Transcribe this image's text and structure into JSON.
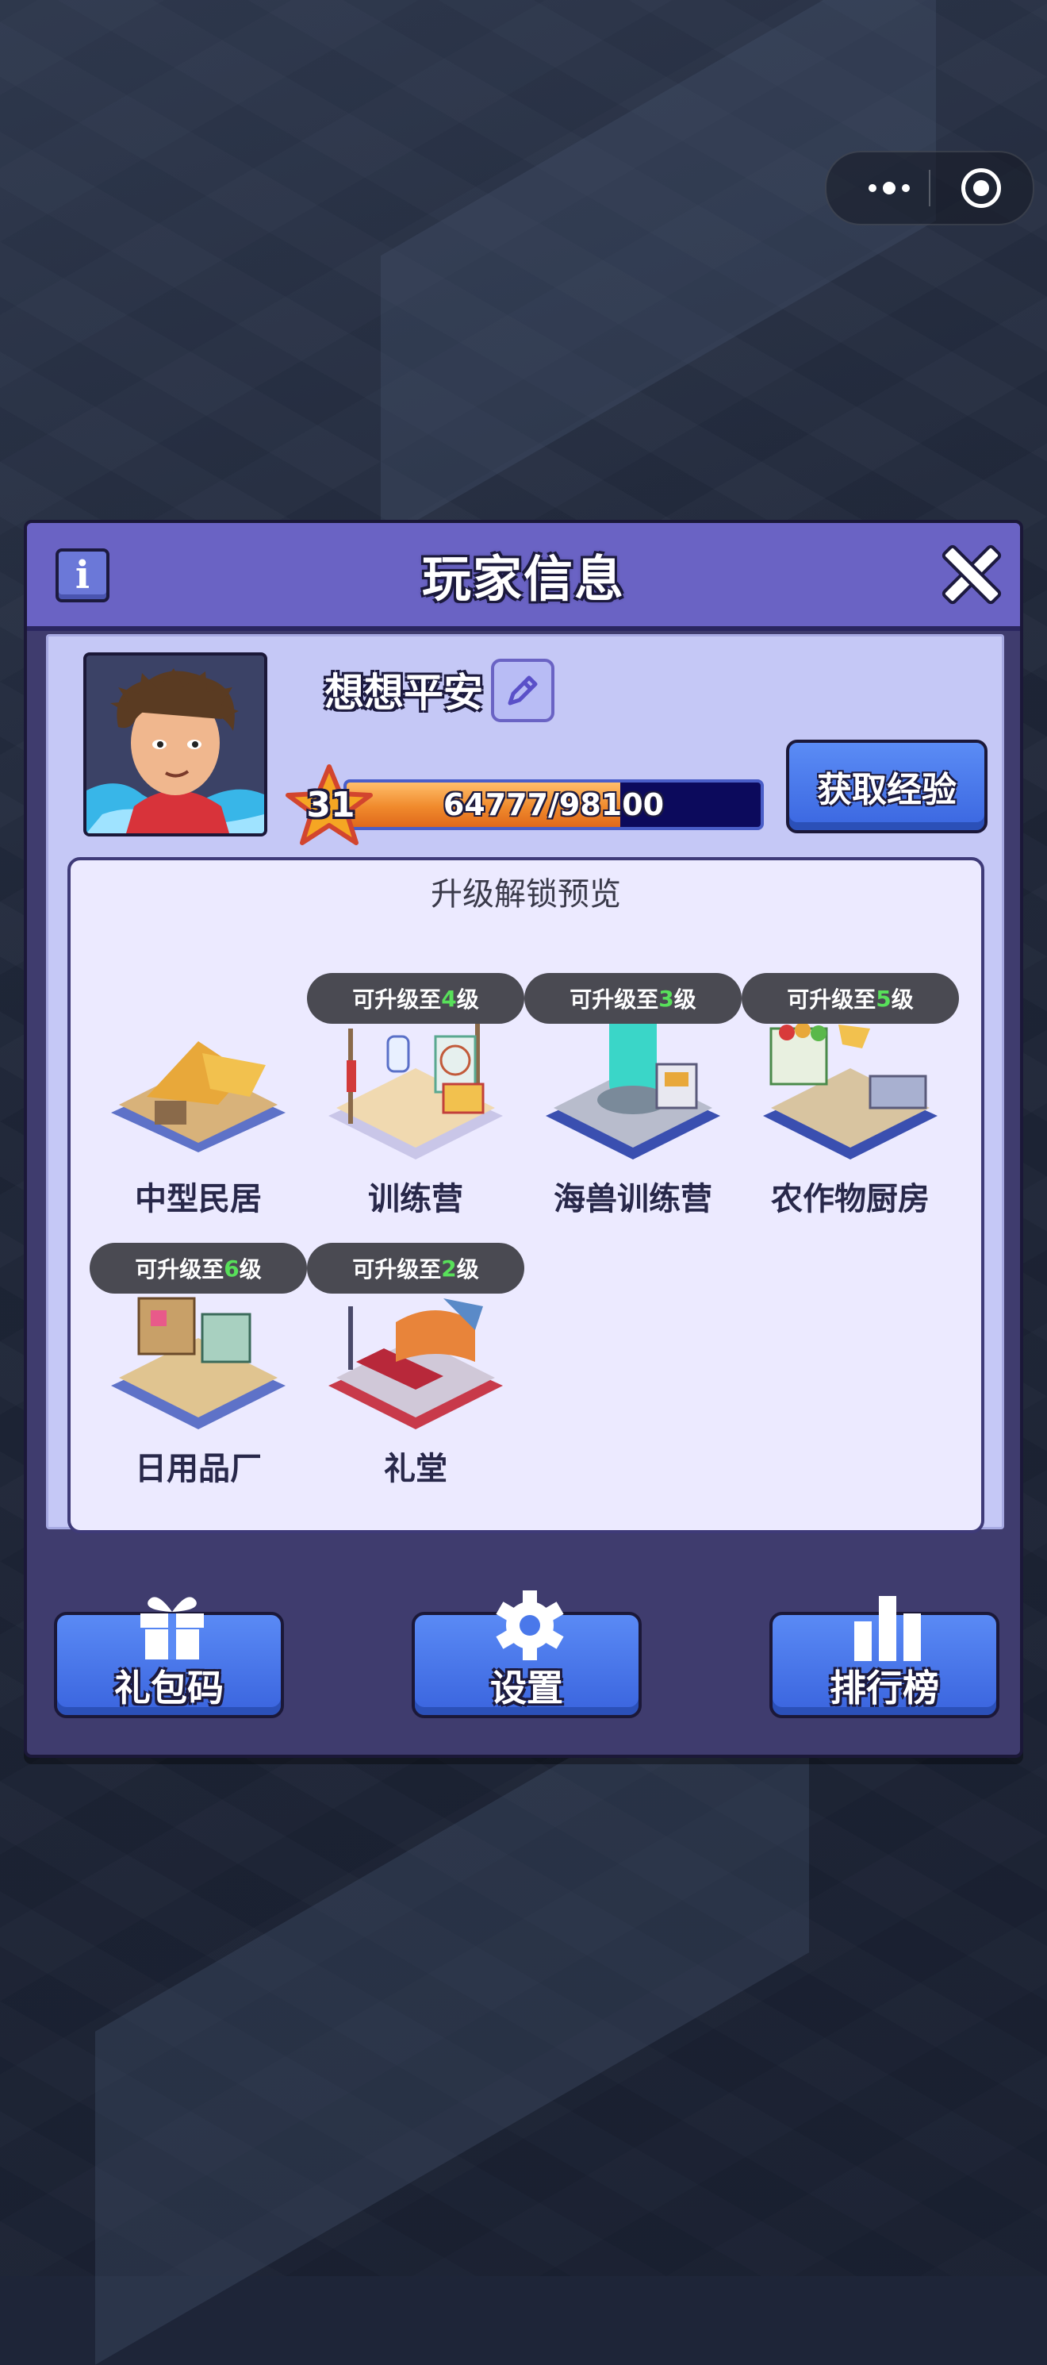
{
  "modal": {
    "title": "玩家信息",
    "info_label": "i"
  },
  "player": {
    "name": "想想平安",
    "level": "31",
    "xp_text": "64777/98100",
    "xp_fraction": 0.66,
    "get_exp_label": "获取经验"
  },
  "preview": {
    "title": "升级解锁预览",
    "badge_prefix": "可升级至",
    "badge_suffix": "级",
    "buildings": [
      {
        "name": "中型民居",
        "upgrade_level": null
      },
      {
        "name": "训练营",
        "upgrade_level": "4"
      },
      {
        "name": "海兽训练营",
        "upgrade_level": "3"
      },
      {
        "name": "农作物厨房",
        "upgrade_level": "5"
      },
      {
        "name": "日用品厂",
        "upgrade_level": "6"
      },
      {
        "name": "礼堂",
        "upgrade_level": "2"
      }
    ]
  },
  "bottom": {
    "gift_label": "礼包码",
    "settings_label": "设置",
    "ranking_label": "排行榜"
  },
  "colors": {
    "header": "#6a63c4",
    "panel": "#c5c8f6",
    "button": "#3a66e0",
    "xp_fill": "#f08a2c",
    "badge_level": "#58e05a"
  }
}
